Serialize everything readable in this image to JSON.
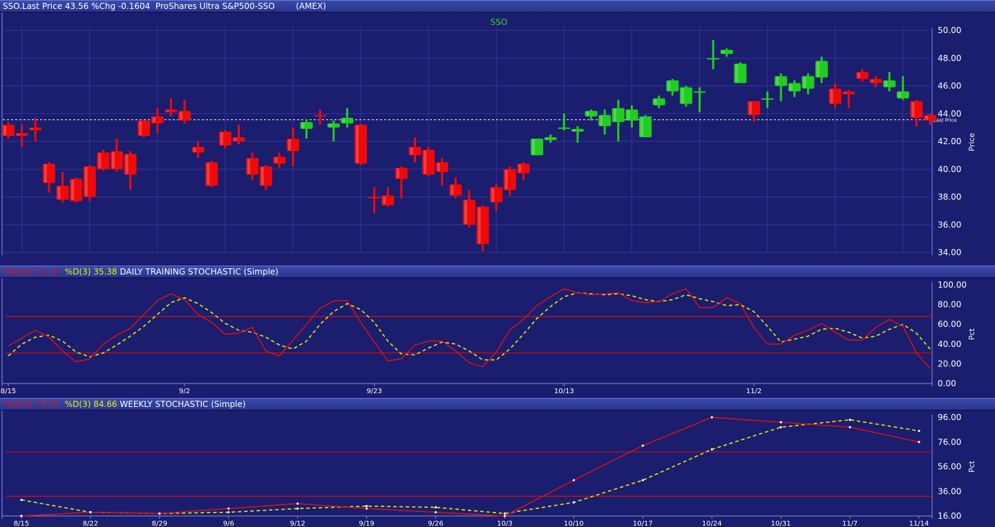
{
  "header": {
    "symbol_label": "SSO.Last Price",
    "last_price": "43.56",
    "pct_change_label": "%Chg",
    "pct_change": "-0.1604",
    "name": "ProShares Ultra S&P500-SSO",
    "exchange": "(AMEX)"
  },
  "daily_header": {
    "k_label": "%K(10)",
    "k_value": "15.15",
    "d_label": "%D(3)",
    "d_value": "35.38",
    "title": "DAILY TRAINING STOCHASTIC (Simple)"
  },
  "weekly_header": {
    "k_label": "%K(10)",
    "k_value": "75.62",
    "d_label": "%D(3)",
    "d_value": "84.66",
    "title": "WEEKLY STOCHASTIC (Simple)"
  },
  "colors": {
    "background": "#1b1d6e",
    "up": "#22cc22",
    "down": "#ee0a0a",
    "k_line": "#e01010",
    "d_line": "#f0f000",
    "grid": "#34379a",
    "axis_text": "#ffffff",
    "symbol_label": "#22dd22"
  },
  "chart_data": [
    {
      "type": "candlestick",
      "title": "SSO",
      "ylabel": "Price",
      "ylim": [
        34,
        50
      ],
      "y_ticks": [
        "50.00",
        "48.00",
        "46.00",
        "44.00",
        "42.00",
        "40.00",
        "38.00",
        "36.00",
        "34.00"
      ],
      "last_price": 43.56,
      "last_price_label": "Last Price",
      "ohlc": [
        [
          43.2,
          43.4,
          42.2,
          42.4
        ],
        [
          42.6,
          43.2,
          41.6,
          42.4
        ],
        [
          43.0,
          43.7,
          42.0,
          42.8
        ],
        [
          40.4,
          40.5,
          38.3,
          39.0
        ],
        [
          38.8,
          39.8,
          37.6,
          37.8
        ],
        [
          39.3,
          39.4,
          37.6,
          37.7
        ],
        [
          40.2,
          40.3,
          37.7,
          38.0
        ],
        [
          41.2,
          41.4,
          39.9,
          40.0
        ],
        [
          41.3,
          42.2,
          39.8,
          40.0
        ],
        [
          41.1,
          41.3,
          38.5,
          39.6
        ],
        [
          43.5,
          43.5,
          42.3,
          42.4
        ],
        [
          43.8,
          44.4,
          42.6,
          43.3
        ],
        [
          44.3,
          45.1,
          43.8,
          44.1
        ],
        [
          44.2,
          45.0,
          43.3,
          43.5
        ],
        [
          41.6,
          42.0,
          40.8,
          41.2
        ],
        [
          40.5,
          40.6,
          38.7,
          38.8
        ],
        [
          42.7,
          42.8,
          41.5,
          41.7
        ],
        [
          42.3,
          43.2,
          41.8,
          42.0
        ],
        [
          40.8,
          41.2,
          39.2,
          39.6
        ],
        [
          40.2,
          40.3,
          38.5,
          38.8
        ],
        [
          40.9,
          41.2,
          40.1,
          40.4
        ],
        [
          42.2,
          43.0,
          40.2,
          41.3
        ],
        [
          42.9,
          43.6,
          42.2,
          43.4
        ],
        [
          43.9,
          44.3,
          43.2,
          43.8
        ],
        [
          43.0,
          43.5,
          42.0,
          43.3
        ],
        [
          43.3,
          44.4,
          43.0,
          43.7
        ],
        [
          43.2,
          43.3,
          40.3,
          40.4
        ],
        [
          38.0,
          38.7,
          36.8,
          37.9
        ],
        [
          38.1,
          38.7,
          37.3,
          37.4
        ],
        [
          40.1,
          40.2,
          37.9,
          39.3
        ],
        [
          41.6,
          42.3,
          40.5,
          41.0
        ],
        [
          41.4,
          41.6,
          39.5,
          39.6
        ],
        [
          40.5,
          40.8,
          38.8,
          39.8
        ],
        [
          38.9,
          39.4,
          37.9,
          38.1
        ],
        [
          37.8,
          38.5,
          35.8,
          36.0
        ],
        [
          37.3,
          37.4,
          34.1,
          34.6
        ],
        [
          38.7,
          38.9,
          37.0,
          37.6
        ],
        [
          40.0,
          40.2,
          38.1,
          38.5
        ],
        [
          40.4,
          40.5,
          39.2,
          39.7
        ],
        [
          41.0,
          42.2,
          41.0,
          42.2
        ],
        [
          42.1,
          42.5,
          41.9,
          42.3
        ],
        [
          43.0,
          44.0,
          42.8,
          43.0
        ],
        [
          42.7,
          43.1,
          41.9,
          42.9
        ],
        [
          43.8,
          44.3,
          43.5,
          44.2
        ],
        [
          43.1,
          44.3,
          42.5,
          43.9
        ],
        [
          43.4,
          45.0,
          42.0,
          44.4
        ],
        [
          43.5,
          44.6,
          43.0,
          44.3
        ],
        [
          42.3,
          43.9,
          42.3,
          43.8
        ],
        [
          44.6,
          45.3,
          44.4,
          45.1
        ],
        [
          45.6,
          46.5,
          45.3,
          46.4
        ],
        [
          44.7,
          46.0,
          44.5,
          45.9
        ],
        [
          45.6,
          45.9,
          44.1,
          45.6
        ],
        [
          48.0,
          49.3,
          47.2,
          48.0
        ],
        [
          48.3,
          48.7,
          48.1,
          48.6
        ],
        [
          46.2,
          47.7,
          46.2,
          47.6
        ],
        [
          44.9,
          44.9,
          43.4,
          43.9
        ],
        [
          45.1,
          45.6,
          44.4,
          45.1
        ],
        [
          46.0,
          46.9,
          44.9,
          46.7
        ],
        [
          45.6,
          46.4,
          45.2,
          46.2
        ],
        [
          45.8,
          46.9,
          45.4,
          46.7
        ],
        [
          46.6,
          48.1,
          46.2,
          47.8
        ],
        [
          45.8,
          46.2,
          44.4,
          44.7
        ],
        [
          45.6,
          45.7,
          44.4,
          45.4
        ],
        [
          47.0,
          47.2,
          46.3,
          46.5
        ],
        [
          46.5,
          46.7,
          45.9,
          46.2
        ],
        [
          45.9,
          47.0,
          45.6,
          46.4
        ],
        [
          45.1,
          46.7,
          45.0,
          45.6
        ],
        [
          44.9,
          45.0,
          43.1,
          43.7
        ],
        [
          43.9,
          44.0,
          43.2,
          43.5
        ]
      ]
    },
    {
      "type": "line",
      "title": "DAILY TRAINING STOCHASTIC (Simple)",
      "ylabel": "Pct",
      "ylim": [
        0,
        100
      ],
      "y_ticks": [
        "100.00",
        "80.00",
        "60.00",
        "40.00",
        "20.00",
        "0.00"
      ],
      "reference_lines": [
        68,
        31
      ],
      "x_labels": [
        {
          "label": "8/15",
          "index": 0
        },
        {
          "label": "9/2",
          "index": 13
        },
        {
          "label": "9/23",
          "index": 27
        },
        {
          "label": "10/13",
          "index": 41
        },
        {
          "label": "11/2",
          "index": 55
        }
      ],
      "series": [
        {
          "name": "%K(10)",
          "values": [
            38,
            46,
            54,
            47,
            33,
            22,
            25,
            40,
            49,
            56,
            70,
            84,
            91,
            85,
            70,
            62,
            50,
            51,
            57,
            33,
            28,
            44,
            60,
            76,
            84,
            84,
            62,
            42,
            23,
            25,
            39,
            43,
            43,
            33,
            21,
            17,
            32,
            54,
            65,
            79,
            88,
            96,
            92,
            90,
            91,
            92,
            84,
            82,
            83,
            91,
            96,
            77,
            77,
            87,
            81,
            57,
            40,
            40,
            49,
            54,
            61,
            52,
            44,
            44,
            57,
            65,
            58,
            31,
            15
          ]
        },
        {
          "name": "%D(3)",
          "values": [
            28,
            40,
            47,
            49,
            43,
            32,
            27,
            31,
            39,
            48,
            58,
            70,
            82,
            87,
            81,
            72,
            61,
            54,
            52,
            47,
            39,
            35,
            43,
            60,
            73,
            81,
            75,
            62,
            43,
            30,
            29,
            36,
            42,
            40,
            33,
            24,
            24,
            35,
            50,
            66,
            78,
            88,
            92,
            91,
            90,
            91,
            89,
            85,
            83,
            85,
            90,
            86,
            83,
            79,
            80,
            73,
            58,
            42,
            45,
            48,
            55,
            56,
            52,
            46,
            48,
            55,
            60,
            51,
            35
          ]
        }
      ]
    },
    {
      "type": "line",
      "title": "WEEKLY STOCHASTIC (Simple)",
      "ylabel": "Pct",
      "ylim": [
        16,
        96
      ],
      "y_ticks": [
        "96.00",
        "76.00",
        "56.00",
        "36.00",
        "16.00"
      ],
      "reference_lines": [
        68,
        32
      ],
      "categories": [
        "8/15",
        "8/22",
        "8/29",
        "9/6",
        "9/12",
        "9/19",
        "9/26",
        "10/3",
        "10/10",
        "10/17",
        "10/24",
        "10/31",
        "11/7",
        "11/14"
      ],
      "series": [
        {
          "name": "%K(10)",
          "values": [
            16,
            19,
            18,
            22,
            26,
            22,
            19,
            16,
            45,
            73,
            96,
            92,
            88,
            76
          ]
        },
        {
          "name": "%D(3)",
          "values": [
            29,
            19,
            18,
            19,
            22,
            24,
            23,
            18,
            27,
            45,
            70,
            88,
            94,
            85
          ]
        }
      ]
    }
  ]
}
